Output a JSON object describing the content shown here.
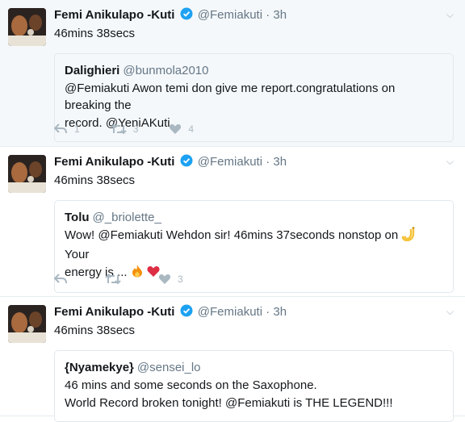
{
  "tweets": [
    {
      "author_name": "Femi Anikulapo -Kuti",
      "author_handle": "@Femiakuti",
      "dot": "·",
      "time": "3h",
      "text": "46mins 38secs",
      "quote": {
        "name": "Dalighieri",
        "handle": "@bunmola2010",
        "lines": [
          "@Femiakuti Awon temi don give me report.congratulations on breaking the",
          "record. @YeniAKuti"
        ]
      },
      "reply_count": "1",
      "retweet_count": "3",
      "like_count": "4"
    },
    {
      "author_name": "Femi Anikulapo -Kuti",
      "author_handle": "@Femiakuti",
      "dot": "·",
      "time": "3h",
      "text": "46mins 38secs",
      "quote": {
        "name": "Tolu",
        "handle": "@_briolette_",
        "line1": "Wow! @Femiakuti Wehdon sir! 46mins 37seconds nonstop on",
        "line1_tail": "Your",
        "line2": "energy is ..."
      },
      "reply_count": "",
      "retweet_count": "",
      "like_count": "3"
    },
    {
      "author_name": "Femi Anikulapo -Kuti",
      "author_handle": "@Femiakuti",
      "dot": "·",
      "time": "3h",
      "text": "46mins 38secs",
      "quote": {
        "name": "{Nyamekye}",
        "handle": "@sensei_lo",
        "lines": [
          "46 mins and some seconds on the Saxophone.",
          "World Record broken tonight! @Femiakuti is THE LEGEND!!!"
        ]
      }
    }
  ],
  "icons": {
    "verified_color": "#1da1f2",
    "action_color": "#aab8c2",
    "fire_color": "#f4900c",
    "heart_color": "#dd2e44",
    "sax_color": "#f5c33b"
  }
}
